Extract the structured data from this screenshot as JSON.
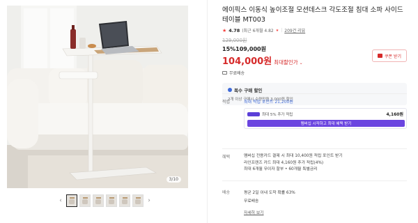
{
  "gallery": {
    "counter": "3/10",
    "thumb_count": 6,
    "active_thumb": 0,
    "prev_arrow": "‹",
    "next_arrow": "›"
  },
  "product": {
    "title": "에이픽스 이동식 높이조절 모션데스크 각도조절 침대 소파 사이드테이블 MT003",
    "rating": "4.78",
    "rating_detail": "(최근 6개월 4.82",
    "reviews": "209건 리뷰",
    "original_price": "129,000원",
    "discount_text": "15%109,000원",
    "price": "104,000원",
    "max_discount": "최대할인가",
    "coupon_label": "쿠폰 받기",
    "free_shipping": "무료배송"
  },
  "bulk": {
    "title": "복수 구매 할인",
    "desc": "2개 이상 구매시 수량만큼 3,000원 할인"
  },
  "points": {
    "label": "적립",
    "max_text": "최대 적립 포인트 21,200원",
    "member_text": "최대 5% 추가 적립",
    "member_points": "4,160원",
    "member_button": "멤버십 시작하고 최대 혜택 받기"
  },
  "benefits": {
    "label": "혜택",
    "lines": [
      "멤버십 전용카드 결제 시 최대 10,400원 적립 포인트 받기",
      "라인프렌즈 카드 최대 4,160원 추가 적립(4%)",
      "최대 6개월 무이자 할부 • 60개월 특별금리"
    ]
  },
  "delivery": {
    "label": "배송",
    "line1": "평균 2일 이내 도착 확률 63%",
    "line2": "무료배송",
    "details_link": "자세히 보기"
  },
  "colors": {
    "accent_red": "#d62a2a",
    "accent_blue": "#3f6ad8",
    "membership_purple": "#6b45e0"
  }
}
